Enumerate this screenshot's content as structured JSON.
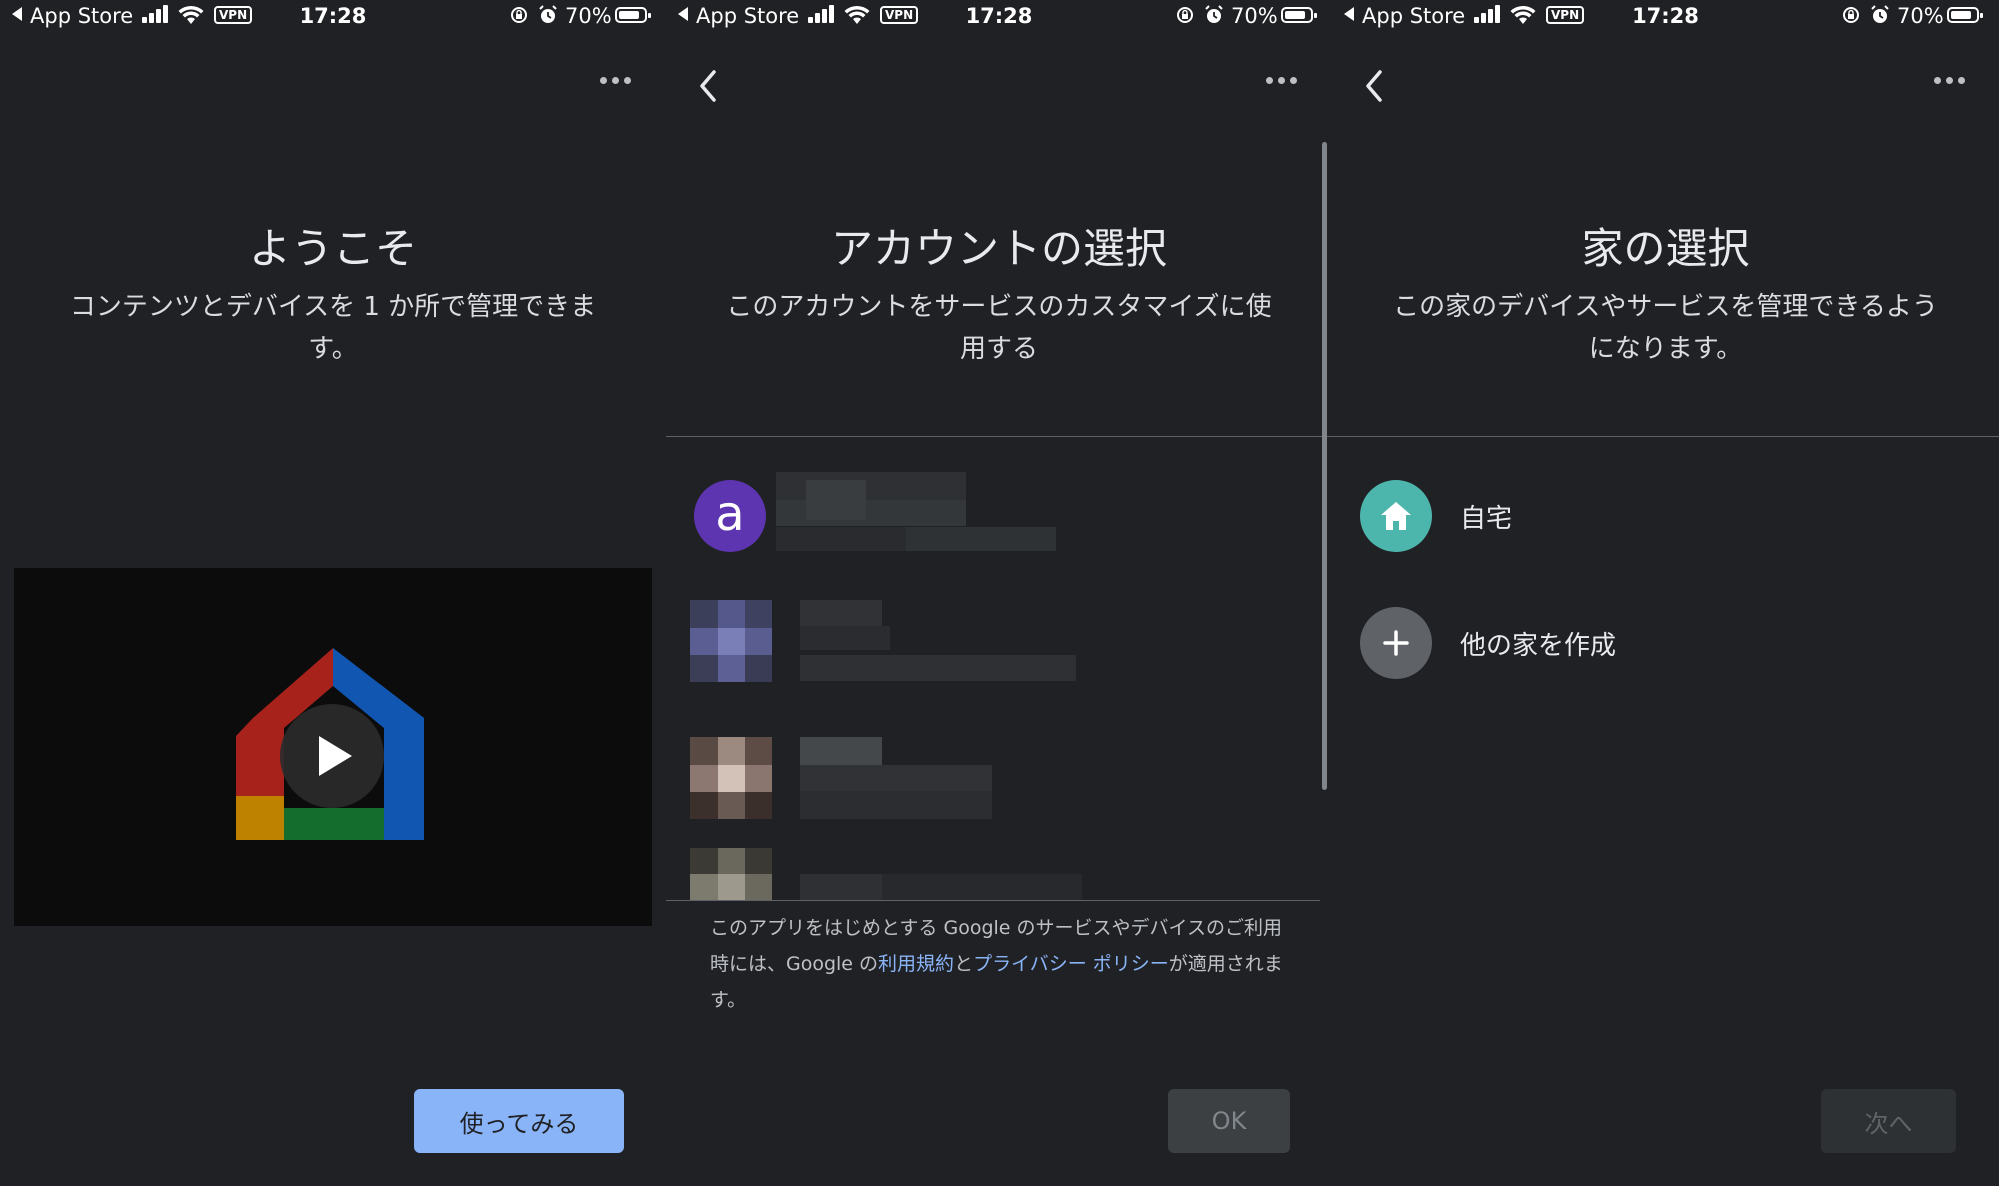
{
  "status_bar": {
    "back_app": "App Store",
    "vpn": "VPN",
    "time": "17:28",
    "battery": "70%"
  },
  "welcome": {
    "title": "ようこそ",
    "subtitle": "コンテンツとデバイスを 1 か所で管理できます。",
    "start_button": "使ってみる"
  },
  "account_select": {
    "title": "アカウントの選択",
    "subtitle": "このアカウントをサービスのカスタマイズに使用する",
    "first_avatar_letter": "a",
    "legal": {
      "prefix": "このアプリをはじめとする Google のサービスやデバイスのご利用時には、Google の",
      "terms_link": "利用規約",
      "and": "と",
      "privacy_link": "プライバシー ポリシー",
      "suffix": "が適用されます。"
    },
    "ok_button": "OK"
  },
  "home_select": {
    "title": "家の選択",
    "subtitle": "この家のデバイスやサービスを管理できるようになります。",
    "homes": [
      {
        "label": "自宅",
        "icon": "home-icon"
      },
      {
        "label": "他の家を作成",
        "icon": "plus-icon"
      }
    ],
    "next_button": "次へ"
  },
  "colors": {
    "background": "#202124",
    "primary_blue": "#8ab4f8",
    "home_teal": "#4db6ac",
    "avatar_purple": "#5e35b1"
  }
}
